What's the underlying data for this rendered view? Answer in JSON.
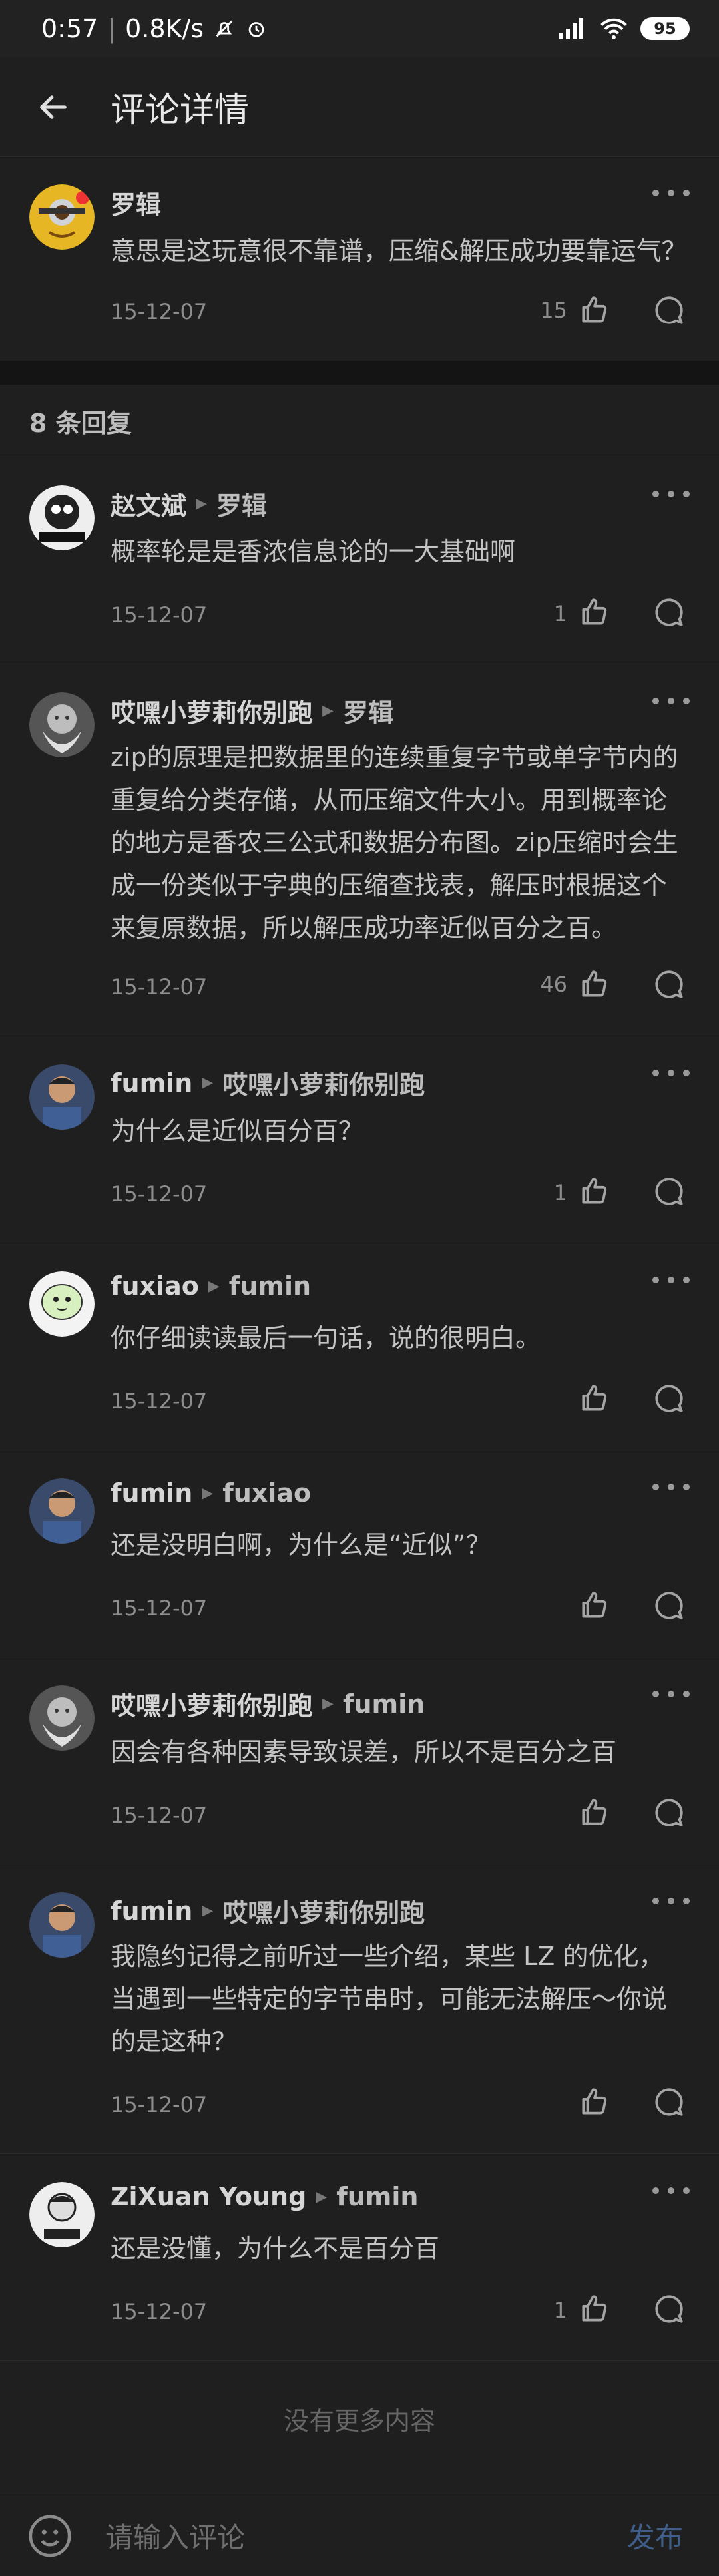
{
  "status_bar": {
    "time": "0:57",
    "speed": "0.8K/s",
    "battery": "95"
  },
  "app_bar": {
    "title": "评论详情"
  },
  "post": {
    "author": "罗辑",
    "content": "意思是这玩意很不靠谱，压缩&解压成功要靠运气？",
    "date": "15-12-07",
    "likes": "15"
  },
  "replies_header": "8 条回复",
  "replies": [
    {
      "author": "赵文斌",
      "target": "罗辑",
      "content": "概率轮是是香浓信息论的一大基础啊",
      "date": "15-12-07",
      "likes": "1"
    },
    {
      "author": "哎嘿小萝莉你别跑",
      "target": "罗辑",
      "content": "zip的原理是把数据里的连续重复字节或单字节内的重复给分类存储，从而压缩文件大小。用到概率论的地方是香农三公式和数据分布图。zip压缩时会生成一份类似于字典的压缩查找表，解压时根据这个来复原数据，所以解压成功率近似百分之百。",
      "date": "15-12-07",
      "likes": "46"
    },
    {
      "author": "fumin",
      "target": "哎嘿小萝莉你别跑",
      "content": "为什么是近似百分百？",
      "date": "15-12-07",
      "likes": "1"
    },
    {
      "author": "fuxiao",
      "target": "fumin",
      "content": "你仔细读读最后一句话，说的很明白。",
      "date": "15-12-07",
      "likes": ""
    },
    {
      "author": "fumin",
      "target": "fuxiao",
      "content": "还是没明白啊，为什么是“近似”？",
      "date": "15-12-07",
      "likes": ""
    },
    {
      "author": "哎嘿小萝莉你别跑",
      "target": "fumin",
      "content": "因会有各种因素导致误差，所以不是百分之百",
      "date": "15-12-07",
      "likes": ""
    },
    {
      "author": "fumin",
      "target": "哎嘿小萝莉你别跑",
      "content": "我隐约记得之前听过一些介绍，某些 LZ 的优化，当遇到一些特定的字节串时，可能无法解压～你说的是这种？",
      "date": "15-12-07",
      "likes": ""
    },
    {
      "author": "ZiXuan Young",
      "target": "fumin",
      "content": "还是没懂，为什么不是百分百",
      "date": "15-12-07",
      "likes": "1"
    }
  ],
  "footer": "没有更多内容",
  "input_bar": {
    "placeholder": "请输入评论",
    "send_label": "发布"
  },
  "colors": {
    "background": "#1a1a1a",
    "panel": "#1f1f1f",
    "accent": "#3f5f8a"
  }
}
